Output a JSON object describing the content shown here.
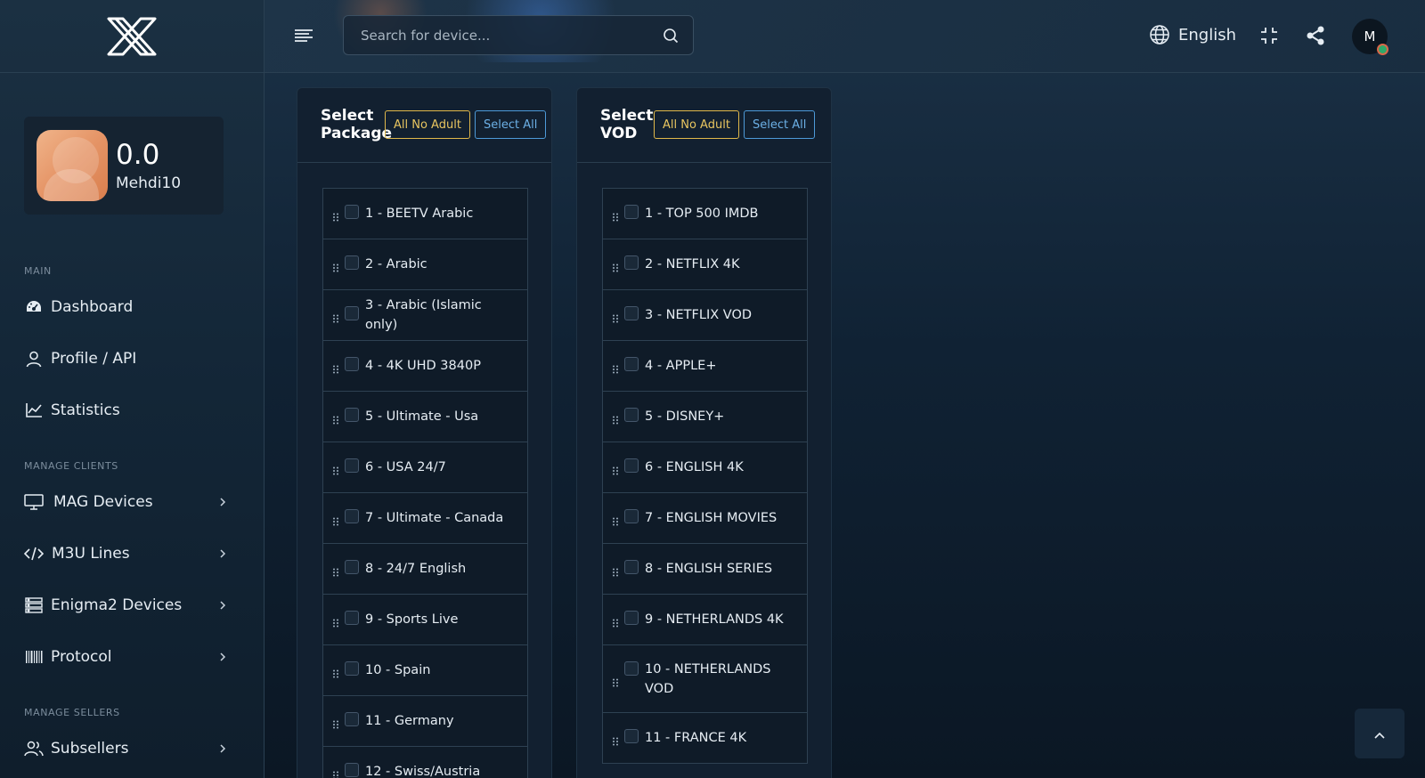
{
  "sidebar": {
    "profile": {
      "balance": "0.0",
      "username": "Mehdi10"
    },
    "sections": {
      "main": "MAIN",
      "manage_clients": "MANAGE CLIENTS",
      "manage_sellers": "MANAGE SELLERS"
    },
    "items": {
      "dashboard": "Dashboard",
      "profile_api": "Profile / API",
      "statistics": "Statistics",
      "mag_devices": "MAG Devices",
      "m3u_lines": "M3U Lines",
      "enigma2_devices": "Enigma2 Devices",
      "protocol": "Protocol",
      "subsellers": "Subsellers"
    }
  },
  "header": {
    "search_placeholder": "Search for device...",
    "language": "English",
    "user_initial": "M"
  },
  "packages": {
    "title": "Select Package",
    "btn_no_adult": "All No Adult",
    "btn_select_all": "Select All",
    "items": [
      "1 - BEETV Arabic",
      "2 - Arabic",
      "3 - Arabic (Islamic only)",
      "4 - 4K UHD 3840P",
      "5 - Ultimate - Usa",
      "6 - USA 24/7",
      "7 - Ultimate - Canada",
      "8 - 24/7 English",
      "9 - Sports Live",
      "10 - Spain",
      "11 - Germany",
      "12 - Swiss/Austria"
    ]
  },
  "vod": {
    "title": "Select VOD",
    "btn_no_adult": "All No Adult",
    "btn_select_all": "Select All",
    "items": [
      "1 - TOP 500 IMDB",
      "2 - NETFLIX 4K",
      "3 - NETFLIX VOD",
      "4 - APPLE+",
      "5 - DISNEY+",
      "6 - ENGLISH 4K",
      "7 - ENGLISH MOVIES",
      "8 - ENGLISH SERIES",
      "9 - NETHERLANDS 4K",
      "10 - NETHERLANDS VOD",
      "11 - FRANCE 4K"
    ]
  },
  "colors": {
    "accent_yellow": "#e0b84a",
    "accent_blue": "#4d9ad8",
    "status_online": "#2fa96a"
  }
}
